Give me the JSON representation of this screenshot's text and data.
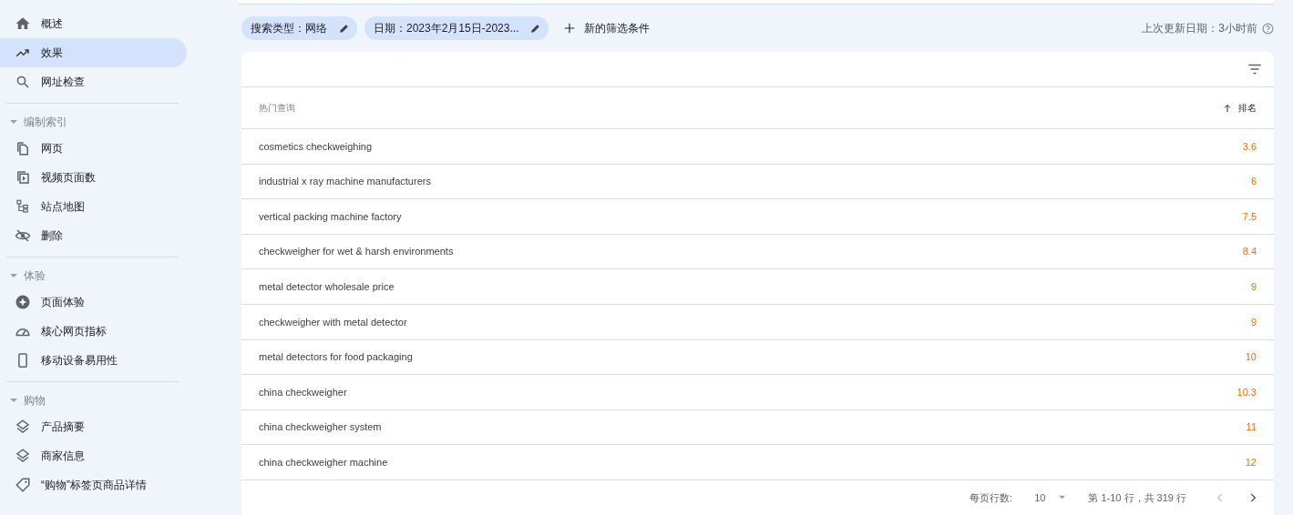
{
  "sidebar": {
    "items": [
      {
        "label": "概述",
        "selected": false
      },
      {
        "label": "效果",
        "selected": true
      },
      {
        "label": "网址检查",
        "selected": false
      }
    ],
    "sections": [
      {
        "title": "编制索引",
        "expanded": true,
        "items": [
          {
            "label": "网页"
          },
          {
            "label": "视频页面数"
          },
          {
            "label": "站点地图"
          },
          {
            "label": "删除"
          }
        ]
      },
      {
        "title": "体验",
        "expanded": true,
        "items": [
          {
            "label": "页面体验"
          },
          {
            "label": "核心网页指标"
          },
          {
            "label": "移动设备易用性"
          }
        ]
      },
      {
        "title": "购物",
        "expanded": true,
        "items": [
          {
            "label": "产品摘要"
          },
          {
            "label": "商家信息"
          },
          {
            "label": "“购物”标签页商品详情"
          }
        ]
      }
    ]
  },
  "filters": [
    {
      "label": "搜索类型：网络"
    },
    {
      "label": "日期：2023年2月15日-2023..."
    }
  ],
  "add_filter": "新的筛选条件",
  "last_updated": "上次更新日期：3小时前",
  "table": {
    "columns": [
      "热门查询",
      "排名"
    ],
    "rows": [
      [
        "cosmetics checkweighing",
        "3.6"
      ],
      [
        "industrial x ray machine manufacturers",
        "6"
      ],
      [
        "vertical packing machine factory",
        "7.5"
      ],
      [
        "checkweigher for wet & harsh environments",
        "8.4"
      ],
      [
        "metal detector wholesale price",
        "9"
      ],
      [
        "checkweigher with metal detector",
        "9"
      ],
      [
        "metal detectors for food packaging",
        "10"
      ],
      [
        "china checkweigher",
        "10.3"
      ],
      [
        "china checkweigher system",
        "11"
      ],
      [
        "china checkweigher machine",
        "12"
      ]
    ]
  },
  "pagination": {
    "rows_per_page_label": "每页行数:",
    "rows_per_page": "10",
    "range": "第 1-10 行，共 319 行"
  }
}
